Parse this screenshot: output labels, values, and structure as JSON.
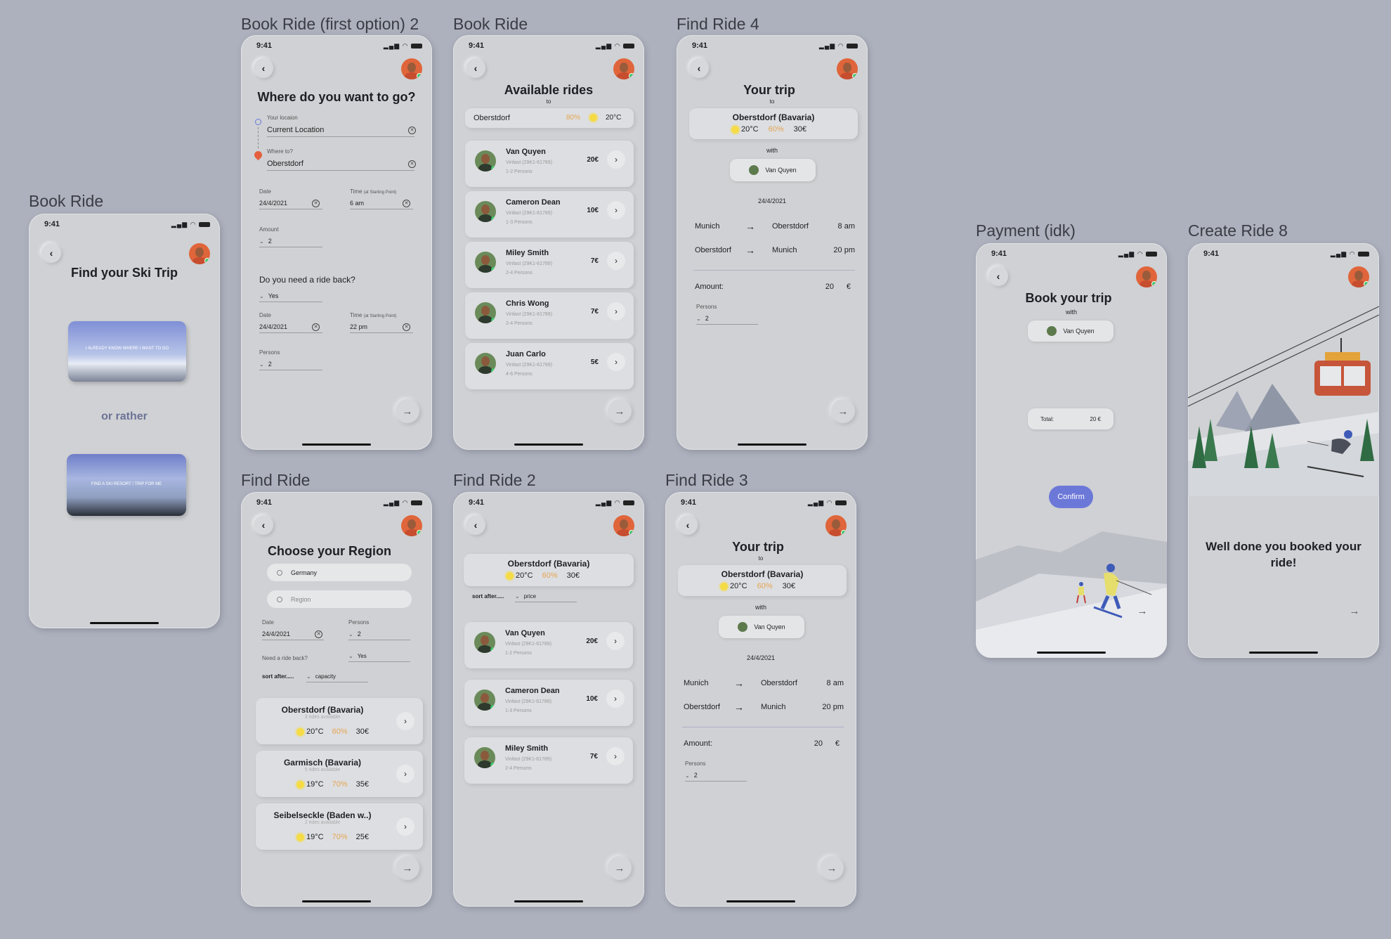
{
  "status_time": "9:41",
  "frames": {
    "book_ride_left": {
      "title": "Book Ride",
      "heading": "Find your Ski Trip",
      "card1": "I ALREADY KNOW WHERE I WANT TO GO",
      "or": "or rather",
      "card2": "FIND A SKI RESORT / TRIP FOR ME"
    },
    "book_first": {
      "title": "Book Ride (first option) 2",
      "heading": "Where do you want to go?",
      "your_location_label": "Your locaion",
      "your_location": "Current Location",
      "where_label": "Where to?",
      "where_value": "Oberstdorf",
      "date_label": "Date",
      "date1": "24/4/2021",
      "time_label": "Time",
      "time_note": "(at Starting Point)",
      "time1": "6 am",
      "amount_label": "Amount",
      "amount": "2",
      "ride_back_q": "Do you need a ride back?",
      "ride_back": "Yes",
      "date2": "24/4/2021",
      "time2": "22 pm",
      "persons_label": "Persons",
      "persons": "2"
    },
    "book_ride": {
      "title": "Book Ride",
      "heading": "Available rides",
      "to": "to",
      "dest": "Oberstdorf",
      "humidity": "80%",
      "temp": "20°C"
    },
    "find4": {
      "title": "Find Ride 4"
    },
    "find": {
      "title": "Find Ride",
      "heading": "Choose your Region",
      "search_value": "Germany",
      "search_placeholder": "Region",
      "date_label": "Date",
      "date": "24/4/2021",
      "persons_label": "Persons",
      "persons": "2",
      "ride_back_label": "Need a ride back?",
      "ride_back": "Yes",
      "sort_label": "sort after.....",
      "sort_value": "capacity",
      "regions": [
        {
          "name": "Oberstdorf  (Bavaria)",
          "avail": "3 rides available",
          "temp": "20°C",
          "hum": "60%",
          "price": "30€"
        },
        {
          "name": "Garmisch  (Bavaria)",
          "avail": "5 rides available",
          "temp": "19°C",
          "hum": "70%",
          "price": "35€"
        },
        {
          "name": "Seibelseckle  (Baden w..)",
          "avail": "2 rides available",
          "temp": "19°C",
          "hum": "70%",
          "price": "25€"
        }
      ]
    },
    "find2": {
      "title": "Find Ride 2",
      "sort_label": "sort after.....",
      "sort_value": "price"
    },
    "find3": {
      "title": "Find Ride 3"
    },
    "payment": {
      "title": "Payment (idk)",
      "heading": "Book your trip",
      "with": "with",
      "driver": "Van Quyen",
      "total_label": "Total:",
      "total": "20 €",
      "confirm": "Confirm"
    },
    "create8": {
      "title": "Create Ride 8",
      "message": "Well done you booked your ride!"
    }
  },
  "trip": {
    "heading": "Your trip",
    "to": "to",
    "dest": "Oberstdorf (Bavaria)",
    "temp": "20°C",
    "hum": "60%",
    "price": "30€",
    "with": "with",
    "driver": "Van Quyen",
    "date": "24/4/2021",
    "legs": [
      {
        "from": "Munich",
        "to": "Oberstdorf",
        "time": "8 am"
      },
      {
        "from": "Oberstdorf",
        "to": "Munich",
        "time": "20 pm"
      }
    ],
    "amount_label": "Amount:",
    "amount": "20",
    "currency": "€",
    "persons_label": "Persons",
    "persons": "2"
  },
  "rides": [
    {
      "name": "Van Quyen",
      "car": "Vinfast (29K1-61789)",
      "persons": "1-2 Persons",
      "price": "20€"
    },
    {
      "name": "Cameron Dean",
      "car": "Vinfast (29K1-61789)",
      "persons": "1-3 Persons",
      "price": "10€"
    },
    {
      "name": "Miley Smith",
      "car": "Vinfast (29K1-61789)",
      "persons": "2-4 Persons",
      "price": "7€"
    },
    {
      "name": "Chris Wong",
      "car": "Vinfast (29K1-61789)",
      "persons": "2-4 Persons",
      "price": "7€"
    },
    {
      "name": "Juan Carlo",
      "car": "Vinfast (29K1-61789)",
      "persons": "4-6 Persons",
      "price": "5€"
    }
  ],
  "icons": {
    "back": "chevron-left-icon",
    "next": "arrow-right-icon",
    "go": "chevron-right-icon",
    "clear": "clear-x-icon",
    "sun": "sun-icon",
    "search": "search-icon"
  },
  "colors": {
    "bg": "#adb1bd",
    "phone": "#cfd1d4",
    "accent": "#6c78d8",
    "orange": "#e7a552",
    "online": "#3ec76a"
  }
}
